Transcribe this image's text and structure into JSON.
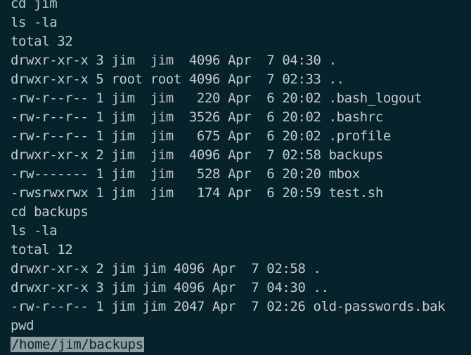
{
  "terminal": {
    "lines": [
      "cd jim",
      "ls -la",
      "total 32",
      "drwxr-xr-x 3 jim  jim  4096 Apr  7 04:30 .",
      "drwxr-xr-x 5 root root 4096 Apr  7 02:33 ..",
      "-rw-r--r-- 1 jim  jim   220 Apr  6 20:02 .bash_logout",
      "-rw-r--r-- 1 jim  jim  3526 Apr  6 20:02 .bashrc",
      "-rw-r--r-- 1 jim  jim   675 Apr  6 20:02 .profile",
      "drwxr-xr-x 2 jim  jim  4096 Apr  7 02:58 backups",
      "-rw------- 1 jim  jim   528 Apr  6 20:20 mbox",
      "-rwsrwxrwx 1 jim  jim   174 Apr  6 20:59 test.sh",
      "cd backups",
      "ls -la",
      "total 12",
      "drwxr-xr-x 2 jim jim 4096 Apr  7 02:58 .",
      "drwxr-xr-x 3 jim jim 4096 Apr  7 04:30 ..",
      "-rw-r--r-- 1 jim jim 2047 Apr  7 02:26 old-passwords.bak",
      "pwd",
      "/home/jim/backups"
    ],
    "background_color": "#06232c",
    "text_color": "#c3c9cc",
    "selection_color": "#8e9ea3"
  }
}
